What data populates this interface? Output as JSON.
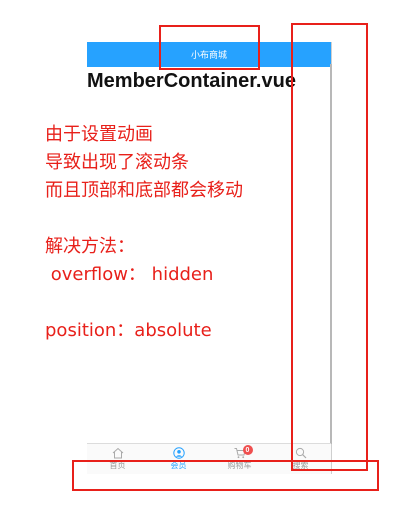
{
  "app": {
    "header_title": "小布商城"
  },
  "tabbar": {
    "items": [
      {
        "label": "首页",
        "icon": "home-icon"
      },
      {
        "label": "会员",
        "icon": "member-icon",
        "active": true
      },
      {
        "label": "购物车",
        "icon": "cart-icon",
        "badge": "0"
      },
      {
        "label": "搜索",
        "icon": "search-icon"
      }
    ]
  },
  "annotation": {
    "file_title": "MemberContainer.vue",
    "notes": [
      "由于设置动画",
      "导致出现了滚动条",
      "而且顶部和底部都会移动",
      "解决方法：",
      " overflow： hidden",
      "position：absolute"
    ]
  },
  "colors": {
    "accent": "#26a2ff",
    "annotation": "#e8201a",
    "badge": "#ef4f4f"
  }
}
